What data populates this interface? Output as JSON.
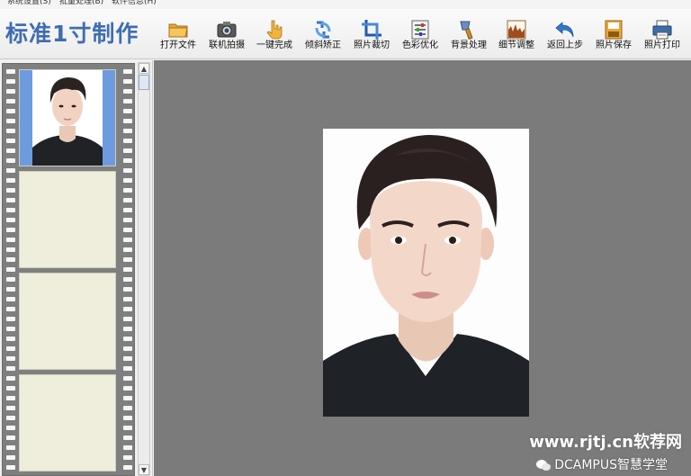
{
  "menu": {
    "items": [
      {
        "label": "系统设置(S)"
      },
      {
        "label": "批量处理(B)"
      },
      {
        "label": "软件信息(H)"
      }
    ]
  },
  "app": {
    "title": "标准1寸制作"
  },
  "toolbar": {
    "buttons": [
      {
        "label": "打开文件",
        "icon": "folder-icon"
      },
      {
        "label": "联机拍摄",
        "icon": "camera-icon"
      },
      {
        "label": "一键完成",
        "icon": "hand-pointer-icon"
      },
      {
        "label": "倾斜矫正",
        "icon": "rotate-icon"
      },
      {
        "label": "照片裁切",
        "icon": "crop-icon"
      },
      {
        "label": "色彩优化",
        "icon": "color-adjust-icon"
      },
      {
        "label": "背景处理",
        "icon": "brush-icon"
      },
      {
        "label": "细节调整",
        "icon": "detail-chart-icon"
      },
      {
        "label": "返回上步",
        "icon": "undo-icon"
      },
      {
        "label": "照片保存",
        "icon": "save-icon"
      },
      {
        "label": "照片打印",
        "icon": "printer-icon"
      }
    ]
  },
  "thumbnails": {
    "count": 4,
    "selected_index": 0
  },
  "watermark": {
    "site": "www.rjtj.cn软荐网",
    "account": "DCAMPUS智慧学堂"
  },
  "colors": {
    "title": "#3f6db1",
    "photo_background": "#6e9be0",
    "canvas": "#7b7b7b",
    "film": "#7f7f7f",
    "empty_frame": "#efeedc"
  }
}
